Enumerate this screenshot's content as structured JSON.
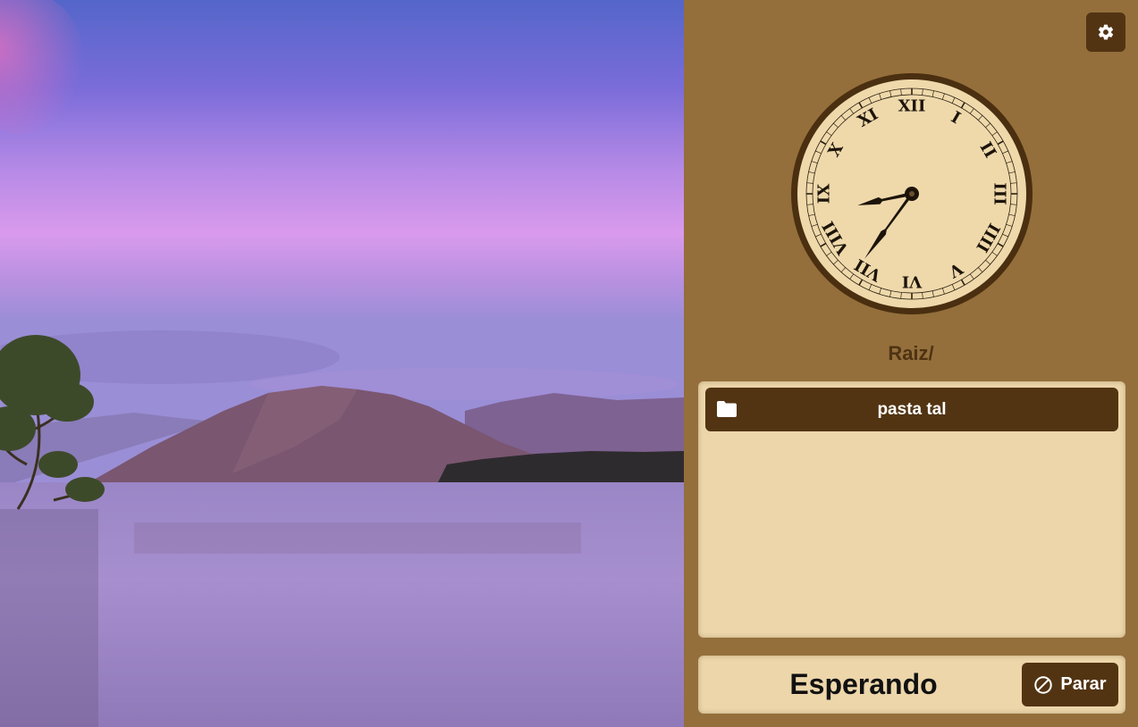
{
  "background": {
    "description_icon": "landscape-image"
  },
  "header": {
    "settings_icon": "gear-icon"
  },
  "clock": {
    "numerals": [
      "XII",
      "I",
      "II",
      "III",
      "IIII",
      "V",
      "VI",
      "VII",
      "VIII",
      "IX",
      "X",
      "XI"
    ],
    "hour": 8,
    "minute": 36,
    "face_color": "#efd9ab",
    "rim_color": "#4a2f10"
  },
  "path": {
    "label": "Raiz/"
  },
  "files": [
    {
      "icon": "folder-icon",
      "label": "pasta tal"
    }
  ],
  "status": {
    "text": "Esperando",
    "stop_label": "Parar",
    "stop_icon": "ban-icon"
  },
  "colors": {
    "panel": "#946f3b",
    "dark": "#523413",
    "light": "#ecd6aa"
  }
}
